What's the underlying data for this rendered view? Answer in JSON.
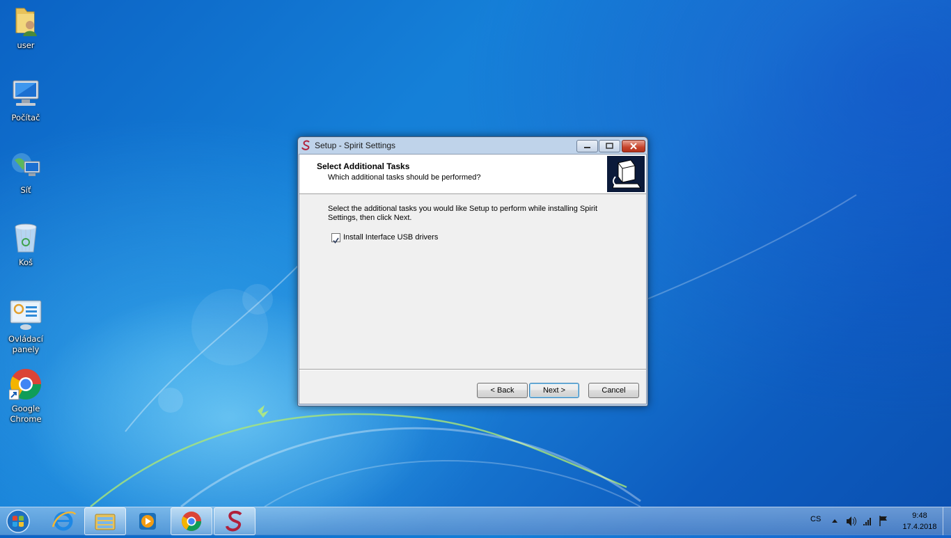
{
  "desktop": {
    "icons": [
      {
        "label": "user",
        "icon": "user-folder-icon"
      },
      {
        "label": "Počítač",
        "icon": "computer-icon"
      },
      {
        "label": "Síť",
        "icon": "network-icon"
      },
      {
        "label": "Koš",
        "icon": "recycle-bin-icon"
      },
      {
        "label": "Ovládací panely",
        "icon": "control-panel-icon"
      },
      {
        "label": "Google Chrome",
        "icon": "chrome-icon"
      }
    ]
  },
  "window": {
    "title": "Setup - Spirit Settings",
    "header_title": "Select Additional Tasks",
    "header_subtitle": "Which additional tasks should be performed?",
    "body_text": "Select the additional tasks you would like Setup to perform while installing Spirit Settings, then click Next.",
    "task": {
      "label": "Install Interface USB drivers",
      "checked": true
    },
    "buttons": {
      "back": "< Back",
      "next": "Next >",
      "cancel": "Cancel"
    }
  },
  "taskbar": {
    "apps": [
      "start-orb-icon",
      "internet-explorer-icon",
      "file-explorer-icon",
      "media-player-icon",
      "chrome-icon",
      "spirit-setup-icon"
    ],
    "language": "CS",
    "time": "9:48",
    "date": "17.4.2018"
  },
  "colors": {
    "accent": "#1a7fd6",
    "window_frame": "#bfd3ea",
    "close_button": "#c7432b"
  }
}
